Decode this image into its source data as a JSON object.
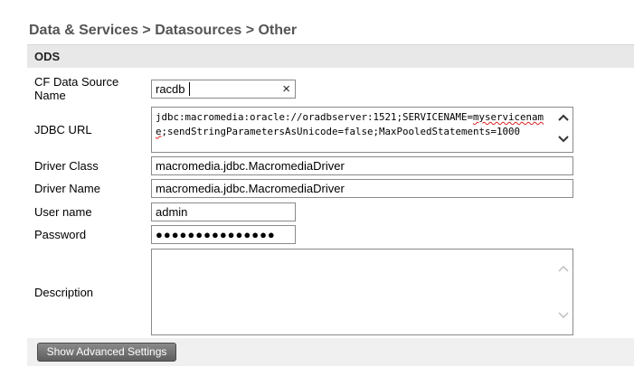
{
  "breadcrumb": "Data & Services > Datasources > Other",
  "section": {
    "title": "ODS"
  },
  "form": {
    "ds_name": {
      "label": "CF Data Source Name",
      "value": "racdb"
    },
    "jdbc_url": {
      "label": "JDBC URL",
      "value_prefix": "jdbc:macromedia:oracle://oradbserver:1521;SERVICENAME=",
      "value_underlined": "myservicename",
      "value_suffix": ";sendStringParametersAsUnicode=false;MaxPooledStatements=1000"
    },
    "driver_class": {
      "label": "Driver Class",
      "value": "macromedia.jdbc.MacromediaDriver"
    },
    "driver_name": {
      "label": "Driver Name",
      "value": "macromedia.jdbc.MacromediaDriver"
    },
    "username": {
      "label": "User name",
      "value": "admin"
    },
    "password": {
      "label": "Password",
      "value": "●●●●●●●●●●●●●●●"
    },
    "description": {
      "label": "Description",
      "value": ""
    }
  },
  "buttons": {
    "advanced": "Show Advanced Settings"
  },
  "icons": {
    "clear": "clear-x-icon",
    "scroll_up": "chevron-up-icon",
    "scroll_down": "chevron-down-icon"
  }
}
